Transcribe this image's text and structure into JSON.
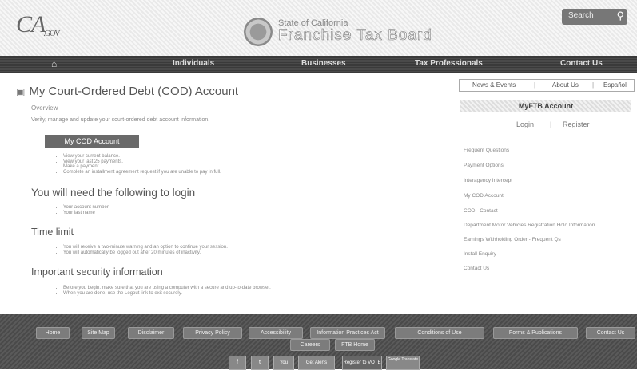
{
  "header": {
    "logo_main": "CA",
    "logo_sub": ".GOV",
    "title_line1": "State of California",
    "title_line2": "Franchise Tax Board",
    "search_label": "Search",
    "search_icon": "search-icon"
  },
  "nav": {
    "home_icon": "home-icon",
    "items": [
      "Individuals",
      "Businesses",
      "Tax Professionals",
      "Contact Us"
    ]
  },
  "main": {
    "title": "My Court-Ordered Debt (COD) Account",
    "overview_heading": "Overview",
    "overview_text": "Verify, manage and update your court-ordered debt account information.",
    "cod_button": "My COD Account",
    "features": [
      "View your current balance.",
      "View your last 25 payments.",
      "Make a payment.",
      "Complete an installment agreement request if you are unable to pay in full."
    ],
    "login_heading": "You will need the following to login",
    "login_items": [
      "Your account number",
      "Your last name"
    ],
    "time_heading": "Time limit",
    "time_items": [
      "You will receive a two-minute warning and an option to continue your session.",
      "You will automatically be logged out after 20 minutes of inactivity."
    ],
    "security_heading": "Important security information",
    "security_items": [
      "Before you begin, make sure that you are using a computer with a secure and up-to-date browser.",
      "When you are done, use the Logout link to exit securely."
    ]
  },
  "sidebar": {
    "top_links": [
      "News & Events",
      "About Us",
      "Español"
    ],
    "myftb_title": "MyFTB Account",
    "login": "Login",
    "register": "Register",
    "links": [
      "Frequent Questions",
      "Payment Options",
      "Interagency Intercept",
      "My COD Account",
      "COD - Contact",
      "Department Motor Vehicles Registration Hold Information",
      "Earnings Withholding Order - Frequent Qs",
      "Install Enquiry",
      "Contact Us"
    ]
  },
  "footer": {
    "row1": [
      "Home",
      "Site Map",
      "Disclaimer",
      "Privacy Policy",
      "Accessibility",
      "Information Practices Act",
      "Conditions of Use",
      "Forms & Publications",
      "Contact Us"
    ],
    "row2": [
      "Careers",
      "FTB Home"
    ],
    "social": [
      "f",
      "t",
      "You Tube",
      "Get Alerts",
      "Register to VOTE",
      "Google Translate"
    ]
  }
}
